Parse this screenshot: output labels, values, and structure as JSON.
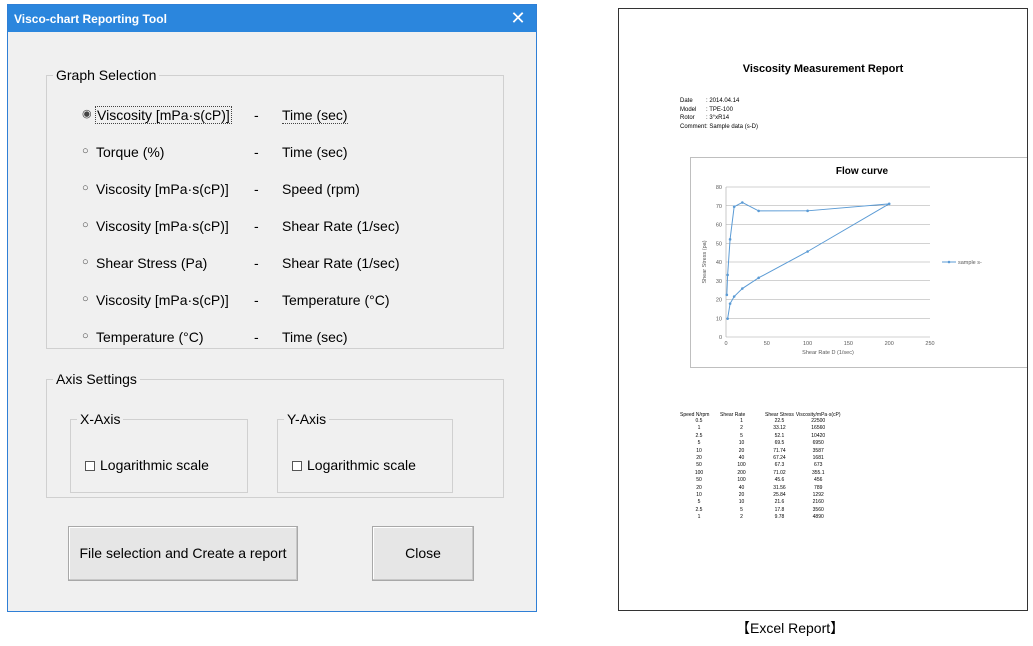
{
  "dialog": {
    "title": "Visco-chart Reporting Tool",
    "close_glyph": "✕",
    "graph_selection": {
      "legend": "Graph Selection",
      "options": [
        {
          "left": "Viscosity [mPa·s(cP)]",
          "dash": "-",
          "right": "Time (sec)",
          "selected": true
        },
        {
          "left": "Torque (%)",
          "dash": "-",
          "right": "Time (sec)",
          "selected": false
        },
        {
          "left": "Viscosity [mPa·s(cP)]",
          "dash": "-",
          "right": "Speed (rpm)",
          "selected": false
        },
        {
          "left": "Viscosity [mPa·s(cP)]",
          "dash": "-",
          "right": "Shear Rate (1/sec)",
          "selected": false
        },
        {
          "left": "Shear Stress (Pa)",
          "dash": "-",
          "right": "Shear Rate (1/sec)",
          "selected": false
        },
        {
          "left": "Viscosity [mPa·s(cP)]",
          "dash": "-",
          "right": "Temperature (°C)",
          "selected": false
        },
        {
          "left": "Temperature (°C)",
          "dash": "-",
          "right": "Time (sec)",
          "selected": false
        }
      ]
    },
    "axis_settings": {
      "legend": "Axis Settings",
      "x_axis": {
        "legend": "X-Axis",
        "checkbox_label": "Logarithmic scale",
        "checked": false
      },
      "y_axis": {
        "legend": "Y-Axis",
        "checkbox_label": "Logarithmic scale",
        "checked": false
      }
    },
    "buttons": {
      "create_report": "File selection and Create a report",
      "close": "Close"
    }
  },
  "report": {
    "title": "Viscosity Measurement Report",
    "meta": [
      {
        "key": "Date",
        "value": ": 2014.04.14"
      },
      {
        "key": "Model",
        "value": ": TPE-100"
      },
      {
        "key": "Rotor",
        "value": ": 3°xR14"
      },
      {
        "key": "Comment",
        "value": ": Sample data (s-D)"
      }
    ],
    "table": {
      "headers": [
        "Speed N/rpm",
        "Shear Rate",
        "Shear Stress",
        "Viscosity/mPa·s(cP)"
      ],
      "rows": [
        [
          "0.5",
          "1",
          "22.5",
          "22500"
        ],
        [
          "1",
          "2",
          "33.12",
          "16560"
        ],
        [
          "2.5",
          "5",
          "52.1",
          "10420"
        ],
        [
          "5",
          "10",
          "69.5",
          "6950"
        ],
        [
          "10",
          "20",
          "71.74",
          "3587"
        ],
        [
          "20",
          "40",
          "67.24",
          "1681"
        ],
        [
          "50",
          "100",
          "67.3",
          "673"
        ],
        [
          "100",
          "200",
          "71.02",
          "355.1"
        ],
        [
          "50",
          "100",
          "45.6",
          "456"
        ],
        [
          "20",
          "40",
          "31.56",
          "789"
        ],
        [
          "10",
          "20",
          "25.84",
          "1292"
        ],
        [
          "5",
          "10",
          "21.6",
          "2160"
        ],
        [
          "2.5",
          "5",
          "17.8",
          "3560"
        ],
        [
          "1",
          "2",
          "9.78",
          "4890"
        ]
      ]
    }
  },
  "chart_data": {
    "type": "line",
    "title": "Flow curve",
    "xlabel": "Shear Rate D (1/sec)",
    "ylabel": "Shear Stress (pa)",
    "xlim": [
      0,
      250
    ],
    "ylim": [
      0,
      80
    ],
    "xticks": [
      0,
      50,
      100,
      150,
      200,
      250
    ],
    "yticks": [
      0,
      10,
      20,
      30,
      40,
      50,
      60,
      70,
      80
    ],
    "grid": true,
    "legend_position": "right",
    "series": [
      {
        "name": "sample s-",
        "color": "#5b9bd5",
        "points": [
          [
            1,
            22.5
          ],
          [
            2,
            33.12
          ],
          [
            5,
            52.1
          ],
          [
            10,
            69.5
          ],
          [
            20,
            71.74
          ],
          [
            40,
            67.24
          ],
          [
            100,
            67.3
          ],
          [
            200,
            71.02
          ],
          [
            100,
            45.6
          ],
          [
            40,
            31.56
          ],
          [
            20,
            25.84
          ],
          [
            10,
            21.6
          ],
          [
            5,
            17.8
          ],
          [
            2,
            9.78
          ]
        ]
      }
    ]
  },
  "caption": "【Excel Report】"
}
